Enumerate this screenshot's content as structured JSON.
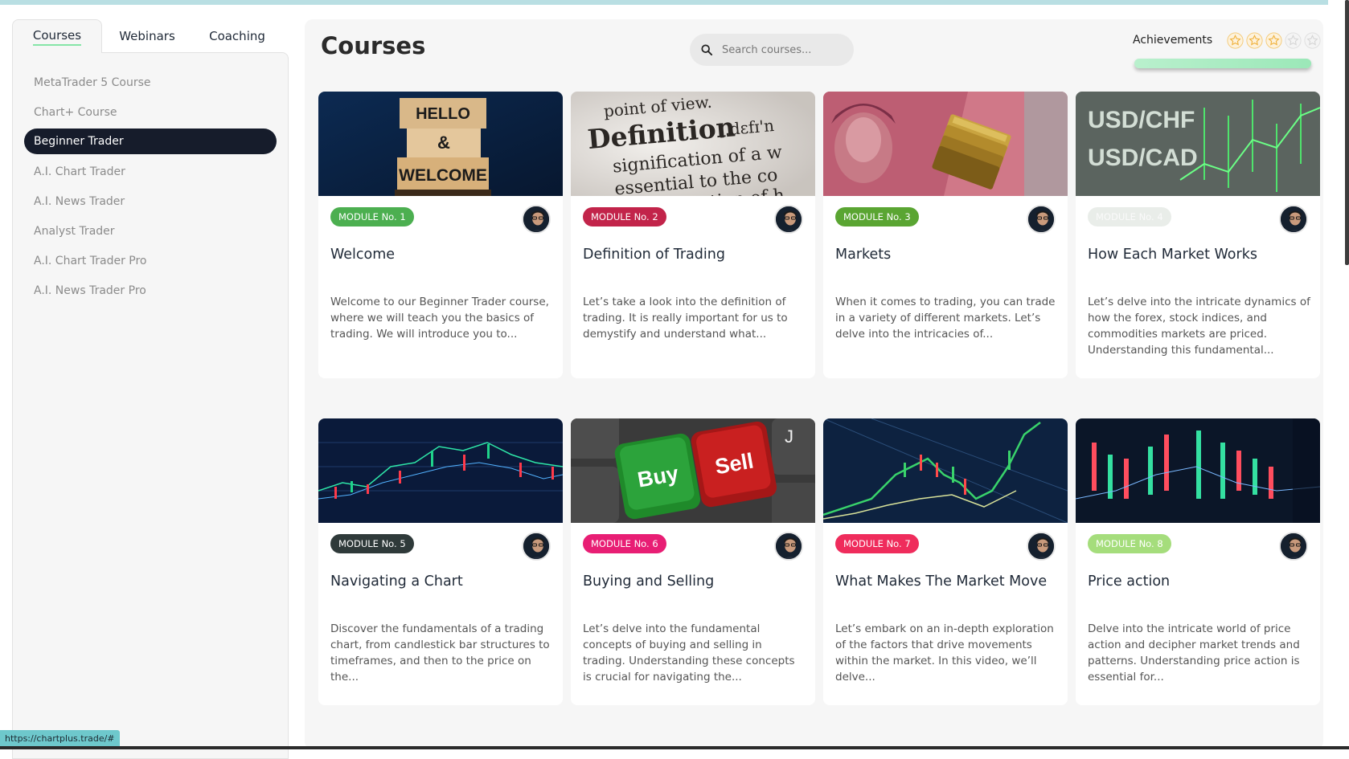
{
  "colors": {
    "accent": "#86e5a8",
    "active_nav_bg": "#161c2b",
    "badge_1": "#4caf50",
    "badge_2": "#c2244a",
    "badge_3": "#5aa532",
    "badge_4": "#e9ede9",
    "badge_5": "#2f3a3a",
    "badge_6": "#e81e74",
    "badge_7": "#ef2c5c",
    "badge_8": "#a5dd7c"
  },
  "tabs": [
    {
      "label": "Courses",
      "active": true
    },
    {
      "label": "Webinars",
      "active": false
    },
    {
      "label": "Coaching",
      "active": false
    }
  ],
  "sidebar": {
    "items": [
      {
        "label": "MetaTrader 5 Course",
        "active": false
      },
      {
        "label": "Chart+ Course",
        "active": false
      },
      {
        "label": "Beginner Trader",
        "active": true
      },
      {
        "label": "A.I. Chart Trader",
        "active": false
      },
      {
        "label": "A.I. News Trader",
        "active": false
      },
      {
        "label": "Analyst Trader",
        "active": false
      },
      {
        "label": "A.I. Chart Trader Pro",
        "active": false
      },
      {
        "label": "A.I. News Trader Pro",
        "active": false
      }
    ]
  },
  "main": {
    "title": "Courses",
    "search_placeholder": "Search courses...",
    "achievements_label": "Achievements",
    "stars_earned": 3,
    "stars_total": 5,
    "progress_fraction": 1.0
  },
  "cards": [
    {
      "badge": "MODULE No. 1",
      "title": "Welcome",
      "desc": "Welcome to our Beginner Trader course, where we will teach you the basics of trading. We will introduce you to...",
      "thumb": "hello-welcome-blocks"
    },
    {
      "badge": "MODULE No. 2",
      "title": "Definition of Trading",
      "desc": "Let’s take a look into the definition of trading. It is really important for us to demystify and understand what...",
      "thumb": "dictionary-definition"
    },
    {
      "badge": "MODULE No. 3",
      "title": "Markets",
      "desc": "When it comes to trading, you can trade in a variety of different markets. Let’s delve into the intricacies of...",
      "thumb": "yuan-and-gold-bars"
    },
    {
      "badge": "MODULE No. 4",
      "title": "How Each Market Works",
      "desc": "Let’s delve into the intricate dynamics of how the forex, stock indices, and commodities markets are priced. Understanding this fundamental...",
      "thumb": "forex-pairs-screen"
    },
    {
      "badge": "MODULE No. 5",
      "title": "Navigating a Chart",
      "desc": "Discover the fundamentals of a trading chart, from candlestick bar structures to timeframes, and then to the price on the...",
      "thumb": "candlestick-chart-screen"
    },
    {
      "badge": "MODULE No. 6",
      "title": "Buying and Selling",
      "desc": "Let’s delve into the fundamental concepts of buying and selling in trading. Understanding these concepts is crucial for navigating the...",
      "thumb": "buy-sell-keyboard"
    },
    {
      "badge": "MODULE No. 7",
      "title": "What Makes The Market Move",
      "desc": "Let’s embark on an in-depth exploration of the factors that drive movements within the market. In this video, we’ll delve...",
      "thumb": "market-chart-lines"
    },
    {
      "badge": "MODULE No. 8",
      "title": "Price action",
      "desc": "Delve into the intricate world of price action and decipher market trends and patterns. Understanding price action is essential for...",
      "thumb": "price-action-candles"
    }
  ],
  "thumb_text": {
    "hello": "HELLO",
    "amp": "&",
    "welcome": "WELCOME",
    "dict_line1": "point of view.",
    "dict_word": "Definition",
    "dict_phon": "[.dɛfɪ'n",
    "dict_line2": "signification of a w",
    "dict_line3": "essential to the co",
    "dict_line4": "explanation of h",
    "usdchf": "USD/CHF",
    "usdcad": "USD/CAD",
    "buy": "Buy",
    "sell": "Sell",
    "key_j": "J"
  },
  "status_url": "https://chartplus.trade/#"
}
